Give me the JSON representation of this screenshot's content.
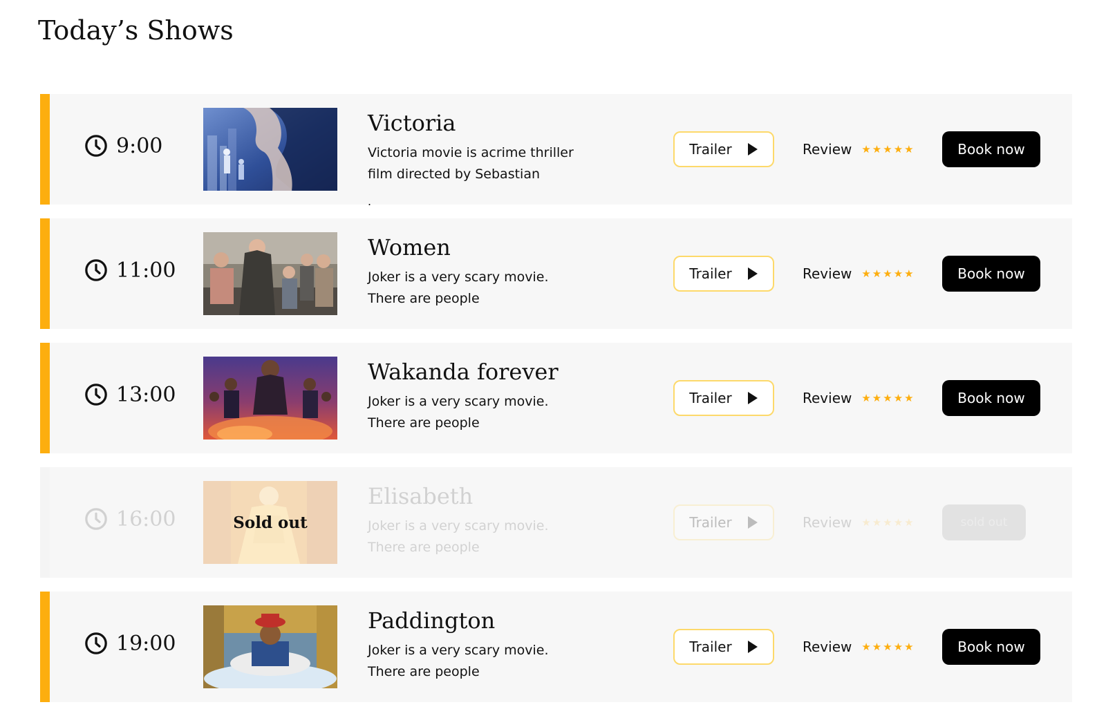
{
  "page": {
    "title": "Today’s Shows"
  },
  "colors": {
    "accent": "#fdae0f",
    "trailer_border": "#fdd96a",
    "row_background": "#f7f7f7",
    "book_button": "#000000",
    "sold_button": "#e2e2e2"
  },
  "icons": {
    "time": "clock-icon",
    "trailer": "play-icon",
    "rating": "star-icon"
  },
  "shows": [
    {
      "time": "9:00",
      "title": "Victoria",
      "description": "Victoria movie is acrime thriller film directed by Sebastian",
      "trailer_label": "Trailer",
      "review_label": "Review",
      "stars": "★★★★★",
      "book_label": "Book now",
      "stray_text": "."
    },
    {
      "time": "11:00",
      "title": "Women",
      "description": "Joker is a very scary movie. There are people",
      "trailer_label": "Trailer",
      "review_label": "Review",
      "stars": "★★★★★",
      "book_label": "Book now"
    },
    {
      "time": "13:00",
      "title": "Wakanda forever",
      "description": "Joker is a very scary movie. There are people",
      "trailer_label": "Trailer",
      "review_label": "Review",
      "stars": "★★★★★",
      "book_label": "Book now"
    },
    {
      "time": "16:00",
      "title": "Elisabeth",
      "description": "Joker is a very scary movie. There are people",
      "trailer_label": "Trailer",
      "review_label": "Review",
      "stars": "★★★★★",
      "book_label": "sold out",
      "poster_overlay": "Sold out",
      "status": "sold out"
    },
    {
      "time": "19:00",
      "title": "Paddington",
      "description": "Joker is a very scary movie. There are people",
      "trailer_label": "Trailer",
      "review_label": "Review",
      "stars": "★★★★★",
      "book_label": "Book now"
    }
  ]
}
